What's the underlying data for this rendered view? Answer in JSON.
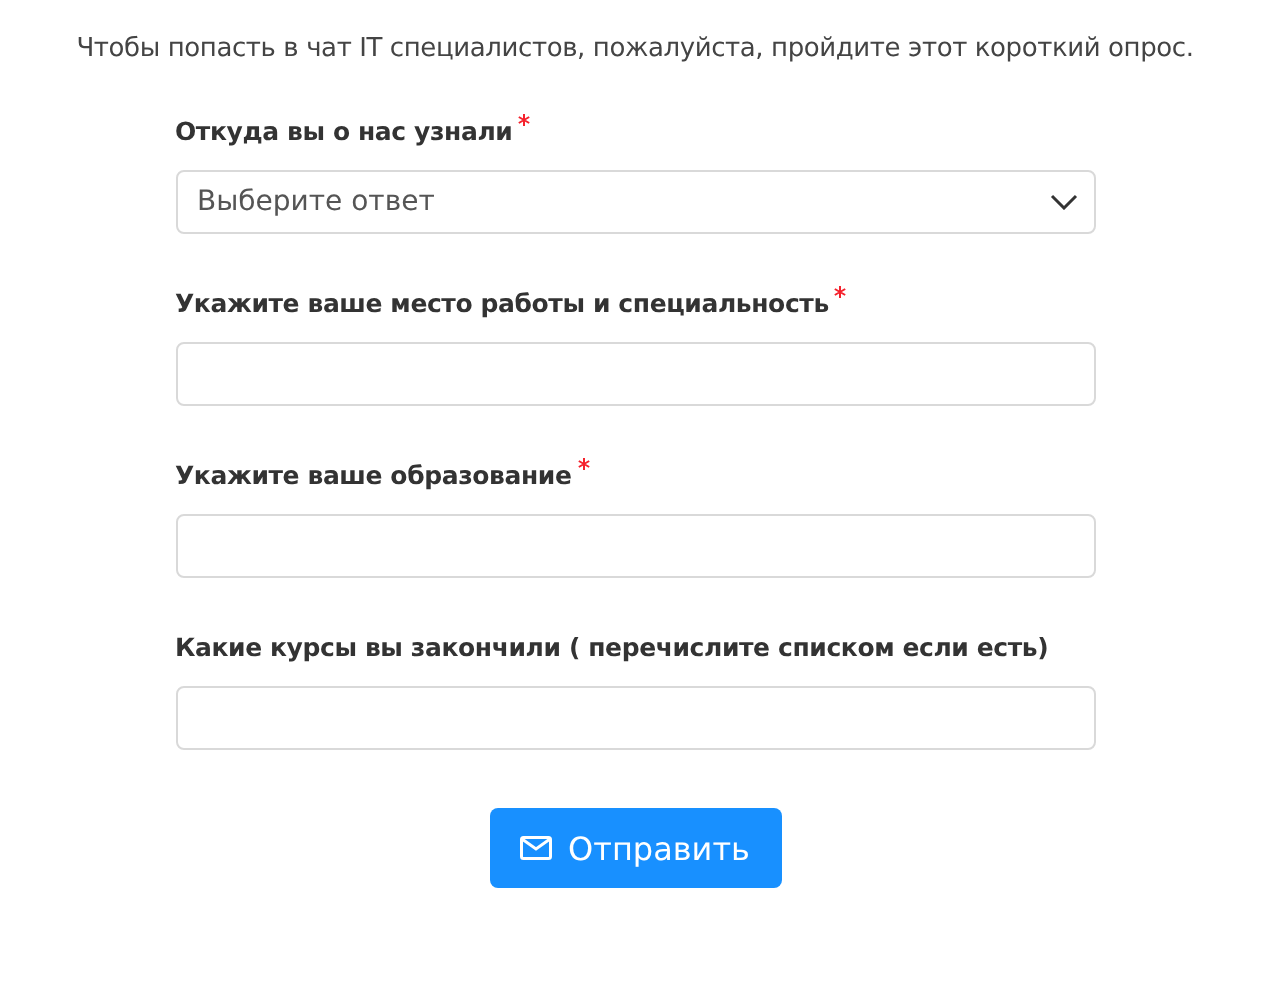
{
  "intro": "Чтобы попасть в чат IT специалистов, пожалуйста, пройдите этот короткий опрос.",
  "questions": [
    {
      "label": "Откуда вы о нас узнали",
      "required": true,
      "kind": "select",
      "placeholder": "Выберите ответ"
    },
    {
      "label": "Укажите ваше место работы и специальность",
      "required": true,
      "kind": "text"
    },
    {
      "label": "Укажите ваше образование",
      "required": true,
      "kind": "text"
    },
    {
      "label": "Какие курсы вы закончили ( перечислите списком если есть)",
      "required": false,
      "kind": "text"
    }
  ],
  "submit": "Отправить"
}
